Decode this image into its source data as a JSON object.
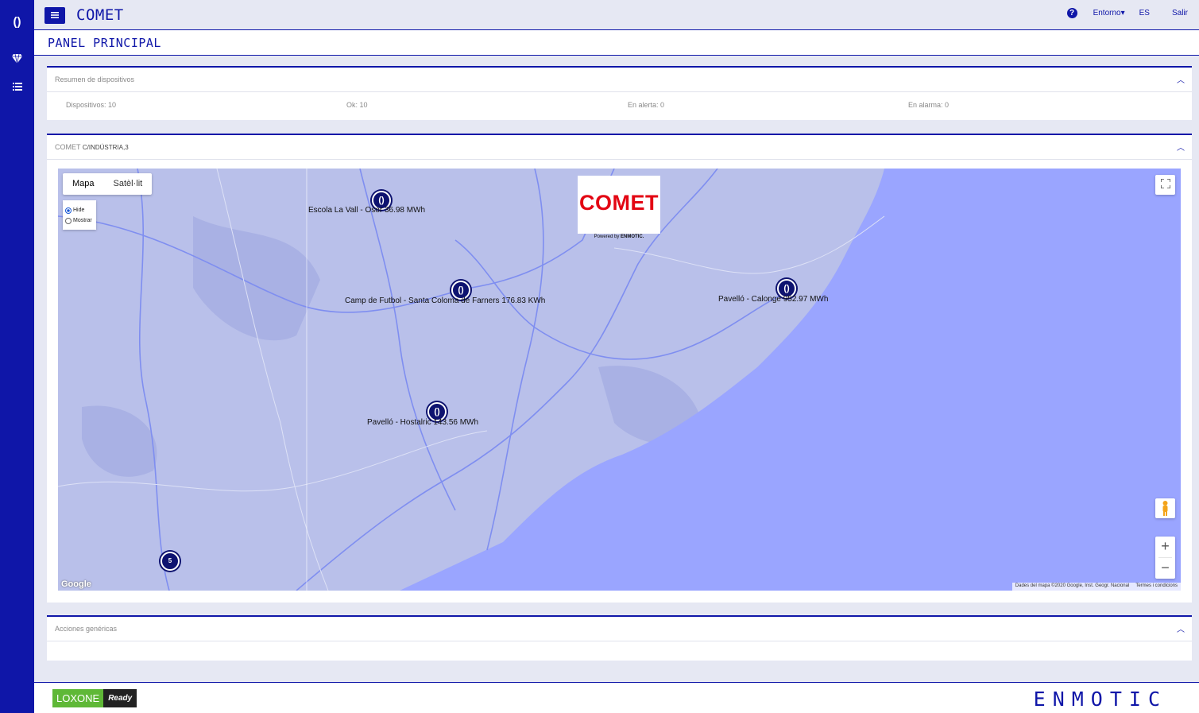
{
  "app": {
    "title": "COMET",
    "menu_icon": "hamburger-icon"
  },
  "sidebar": {
    "icons": [
      "logo-icon",
      "diamond-icon",
      "list-icon"
    ],
    "logo_glyph": "()"
  },
  "topbar": {
    "help_icon": "question-circle-icon",
    "environment": "Entorno",
    "language": "ES",
    "logout": "Salir"
  },
  "page": {
    "title": "PANEL PRINCIPAL"
  },
  "summary": {
    "title": "Resumen de dispositivos",
    "stats": [
      "Dispositivos: 10",
      "Ok: 10",
      "En alerta: 0",
      "En alarma: 0"
    ]
  },
  "map_panel": {
    "title": "COMET",
    "title_address": "C/INDÚSTRIA,3",
    "tabs": [
      "Mapa",
      "Satèl·lit"
    ],
    "radios": [
      "Hide",
      "Mostrar"
    ],
    "logo_text": "COMET",
    "powered_by": "Powered by",
    "powered_brand": "ENMOTIC.",
    "markers": [
      {
        "glyph": "()",
        "label": "Escola La Vall - Osor 36.98 MWh"
      },
      {
        "glyph": "()",
        "label": "Camp de Futbol - Santa Coloma de Farners 176.83 KWh"
      },
      {
        "glyph": "()",
        "label": "Pavelló - Calonge 952.97 MWh"
      },
      {
        "glyph": "()",
        "label": "Pavelló - Hostalric 143.56 MWh"
      },
      {
        "glyph": "5",
        "label": ""
      }
    ],
    "attribution": "Dades del mapa ©2020 Google, Inst. Geogr. Nacional",
    "terms": "Termes i condicions",
    "google": "Google",
    "zoom_in": "+",
    "zoom_out": "−"
  },
  "actions": {
    "title": "Acciones genéricas"
  },
  "footer": {
    "loxone": "LOXONE",
    "loxone_ready": "Ready",
    "brand": "ENMOTIC"
  },
  "colors": {
    "primary": "#0f16a8",
    "map_land": "#b7bfe8",
    "map_sea": "#9aa5ff",
    "logo_red": "#e30613",
    "loxone_green": "#5fb837"
  }
}
